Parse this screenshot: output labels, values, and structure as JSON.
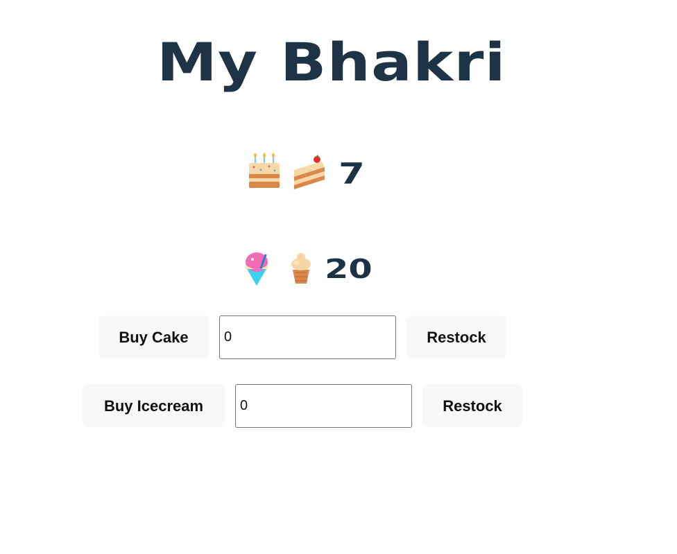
{
  "app": {
    "title": "My Bhakri"
  },
  "stock": {
    "cake": {
      "icons": [
        "birthday-cake-icon",
        "cake-slice-icon"
      ],
      "count": "7"
    },
    "icecream": {
      "icons": [
        "shaved-ice-icon",
        "ice-cream-cone-icon"
      ],
      "count": "20"
    }
  },
  "controls": {
    "cake": {
      "buy_label": "Buy Cake",
      "quantity_value": "0",
      "restock_label": "Restock"
    },
    "icecream": {
      "buy_label": "Buy Icecream",
      "quantity_value": "0",
      "restock_label": "Restock"
    }
  },
  "colors": {
    "heading": "#1f3347",
    "button_bg": "#f8f8f8",
    "input_border": "#767676"
  }
}
